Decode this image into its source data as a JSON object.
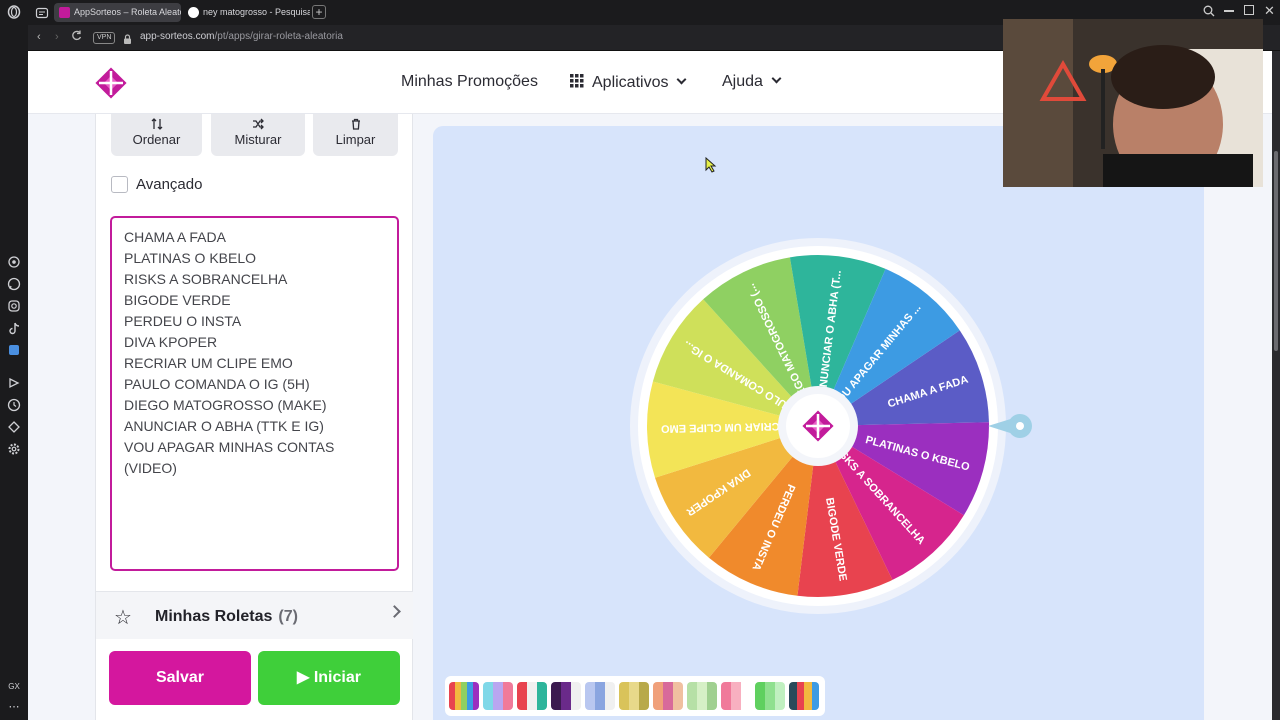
{
  "browser": {
    "tabs": [
      {
        "title": "AppSorteos – Roleta Aleatória",
        "active": true
      },
      {
        "title": "ney matogrosso - Pesquisa",
        "active": false
      }
    ],
    "url_host": "app-sorteos.com",
    "url_path": "/pt/apps/girar-roleta-aleatoria",
    "vpn_label": "VPN",
    "side_label": "GX"
  },
  "header": {
    "menu": {
      "promotions": "Minhas Promoções",
      "apps": "Aplicativos",
      "help": "Ajuda"
    }
  },
  "toolbar": {
    "sort": "Ordenar",
    "shuffle": "Misturar",
    "clear": "Limpar"
  },
  "advanced": {
    "label": "Avançado",
    "checked": false
  },
  "entries_text": "CHAMA A FADA\nPLATINAS O KBELO\nRISKS A SOBRANCELHA\nBIGODE VERDE\nPERDEU O INSTA\nDIVA KPOPER\nRECRIAR UM CLIPE EMO\nPAULO COMANDA O IG (5H)\nDIEGO MATOGROSSO (MAKE)\nANUNCIAR O ABHA (TTK E IG)\nVOU APAGAR MINHAS CONTAS (VIDEO)",
  "my_wheels": {
    "label": "Minhas Roletas",
    "count": "(7)"
  },
  "actions": {
    "save": "Salvar",
    "start": "Iniciar"
  },
  "wheel": {
    "segments": [
      {
        "label": "CHAMA A FADA",
        "color": "#5b5cc6"
      },
      {
        "label": "PLATINAS O KBELO",
        "color": "#9b2fbf"
      },
      {
        "label": "RISKS A SOBRANCELHA",
        "color": "#d6258d"
      },
      {
        "label": "BIGODE VERDE",
        "color": "#e8434f"
      },
      {
        "label": "PERDEU O INSTA",
        "color": "#f08a2c"
      },
      {
        "label": "DIVA KPOPER",
        "color": "#f2b93f"
      },
      {
        "label": "RECRIAR UM CLIPE EMO",
        "color": "#f3e457"
      },
      {
        "label": "PAULO COMANDA O IG...",
        "color": "#cfe05a"
      },
      {
        "label": "DIEGO MATOGROSSO (...",
        "color": "#8fd062"
      },
      {
        "label": "ANUNCIAR O ABHA (T...",
        "color": "#2eb59b"
      },
      {
        "label": "VOU APAGAR MINHAS ...",
        "color": "#3d9be3"
      }
    ]
  },
  "palettes": [
    [
      "#e8434f",
      "#f2b93f",
      "#8fd062",
      "#3d9be3",
      "#9b2fbf"
    ],
    [
      "#7fd8e8",
      "#b9a6f0",
      "#f07a9a"
    ],
    [
      "#e8434f",
      "#f0f0f0",
      "#2eb59b"
    ],
    [
      "#3b1a4f",
      "#6a2a8a",
      "#f0f0f0"
    ],
    [
      "#b9c7f0",
      "#8aa5e0",
      "#f0f0f0"
    ],
    [
      "#d9c35a",
      "#e8d98a",
      "#b8a94a"
    ],
    [
      "#f0a07a",
      "#d86a9a",
      "#f0c0a0"
    ],
    [
      "#b6e0a6",
      "#d6f0c6",
      "#a0d090"
    ],
    [
      "#f07a9a",
      "#f8b0c0",
      "#ffffff"
    ],
    [
      "#5fd05f",
      "#8fe08f",
      "#c0f0c0"
    ],
    [
      "#2a4a5a",
      "#e8434f",
      "#f2b93f",
      "#3d9be3"
    ]
  ]
}
